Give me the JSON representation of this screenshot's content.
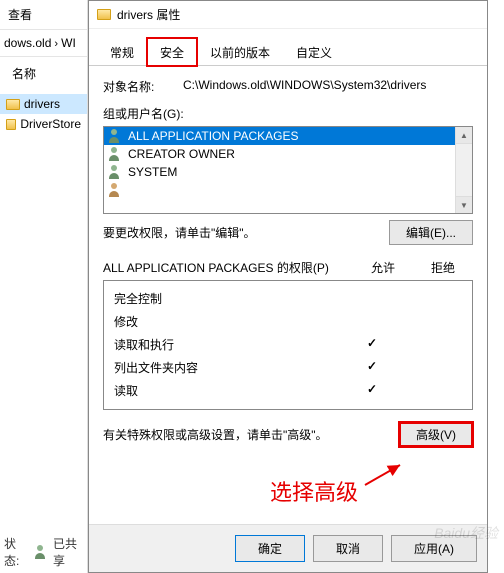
{
  "bg": {
    "toolbtn": "查看",
    "crumb1": "dows.old",
    "crumb2": "WI",
    "col_header": "名称",
    "items": [
      "drivers",
      "DriverStore"
    ],
    "status": "状态:",
    "status2": "已共享"
  },
  "dialog": {
    "title": "drivers 属性",
    "tabs": [
      "常规",
      "安全",
      "以前的版本",
      "自定义"
    ],
    "object_label": "对象名称:",
    "object_value": "C:\\Windows.old\\WINDOWS\\System32\\drivers",
    "groups_label": "组或用户名(G):",
    "groups": [
      "ALL APPLICATION PACKAGES",
      "CREATOR OWNER",
      "SYSTEM"
    ],
    "edit_hint": "要更改权限，请单击\"编辑\"。",
    "edit_btn": "编辑(E)...",
    "perm_title": "ALL APPLICATION PACKAGES 的权限(P)",
    "perm_allow": "允许",
    "perm_deny": "拒绝",
    "perms": [
      {
        "name": "完全控制",
        "allow": false,
        "deny": false
      },
      {
        "name": "修改",
        "allow": false,
        "deny": false
      },
      {
        "name": "读取和执行",
        "allow": true,
        "deny": false
      },
      {
        "name": "列出文件夹内容",
        "allow": true,
        "deny": false
      },
      {
        "name": "读取",
        "allow": true,
        "deny": false
      }
    ],
    "adv_hint": "有关特殊权限或高级设置，请单击\"高级\"。",
    "adv_btn": "高级(V)",
    "ok": "确定",
    "cancel": "取消",
    "apply": "应用(A)"
  },
  "annotation": "选择高级",
  "watermark": "Baidu经验"
}
